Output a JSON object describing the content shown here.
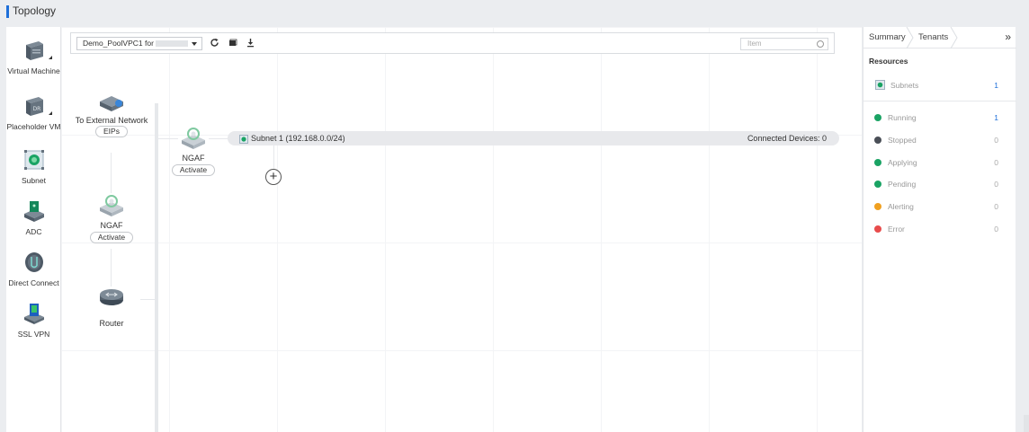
{
  "header": {
    "title": "Topology"
  },
  "palette": {
    "items": [
      {
        "label": "Virtual Machine",
        "icon": "server-icon"
      },
      {
        "label": "Placeholder VM",
        "icon": "dr-server-icon"
      },
      {
        "label": "Subnet",
        "icon": "subnet-icon"
      },
      {
        "label": "ADC",
        "icon": "adc-icon"
      },
      {
        "label": "Direct Connect",
        "icon": "direct-connect-icon"
      },
      {
        "label": "SSL VPN",
        "icon": "ssl-vpn-icon"
      }
    ]
  },
  "toolbar": {
    "vpc_select_value": "Demo_PoolVPC1 for",
    "refresh_icon": "refresh-icon",
    "layout_icon": "square-icon",
    "download_icon": "download-icon",
    "search_placeholder": "Item"
  },
  "topology": {
    "external_network": {
      "label": "To External Network",
      "pill": "EIPs"
    },
    "ngaf_left": {
      "label": "NGAF",
      "pill": "Activate"
    },
    "router": {
      "label": "Router"
    },
    "ngaf_top": {
      "label": "NGAF",
      "pill": "Activate"
    },
    "subnet_bar": {
      "label": "Subnet 1 (192.168.0.0/24)",
      "devices": "Connected Devices: 0"
    }
  },
  "right_panel": {
    "tabs": [
      "Summary",
      "Tenants"
    ],
    "resources_title": "Resources",
    "subnets": {
      "label": "Subnets",
      "count": "1"
    },
    "statuses": [
      {
        "label": "Running",
        "count": "1",
        "color": "#1aa364"
      },
      {
        "label": "Stopped",
        "count": "0",
        "color": "#4a4f57"
      },
      {
        "label": "Applying",
        "count": "0",
        "color": "#1aa364"
      },
      {
        "label": "Pending",
        "count": "0",
        "color": "#1aa364"
      },
      {
        "label": "Alerting",
        "count": "0",
        "color": "#f0a020"
      },
      {
        "label": "Error",
        "count": "0",
        "color": "#e84c4c"
      }
    ]
  },
  "colors": {
    "accent": "#1e6fd9",
    "link_count": "#1e6fd9"
  }
}
